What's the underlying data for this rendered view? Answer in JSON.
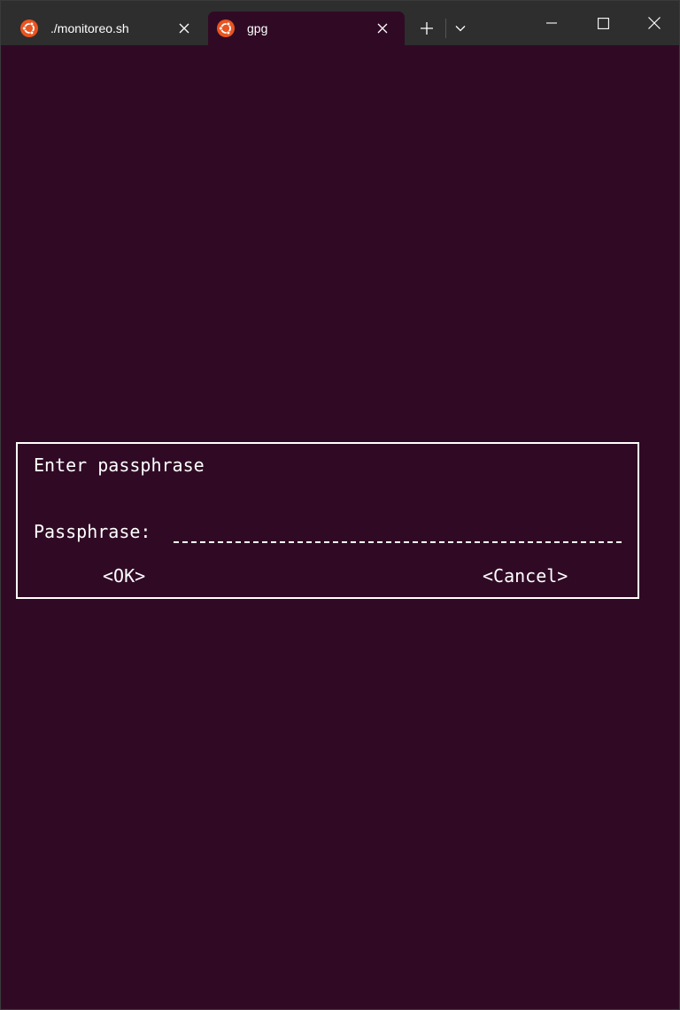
{
  "tabs": [
    {
      "label": "./monitoreo.sh",
      "active": false,
      "icon": "ubuntu-icon"
    },
    {
      "label": "gpg",
      "active": true,
      "icon": "ubuntu-icon"
    }
  ],
  "colors": {
    "terminal_bg": "#300a24",
    "titlebar_bg": "#2e2e2e",
    "ubuntu_orange": "#e95420",
    "foreground": "#ffffff"
  },
  "dialog": {
    "title": "Enter passphrase",
    "field_label": "Passphrase:",
    "field_value": "",
    "ok_label": "<OK>",
    "cancel_label": "<Cancel>"
  }
}
